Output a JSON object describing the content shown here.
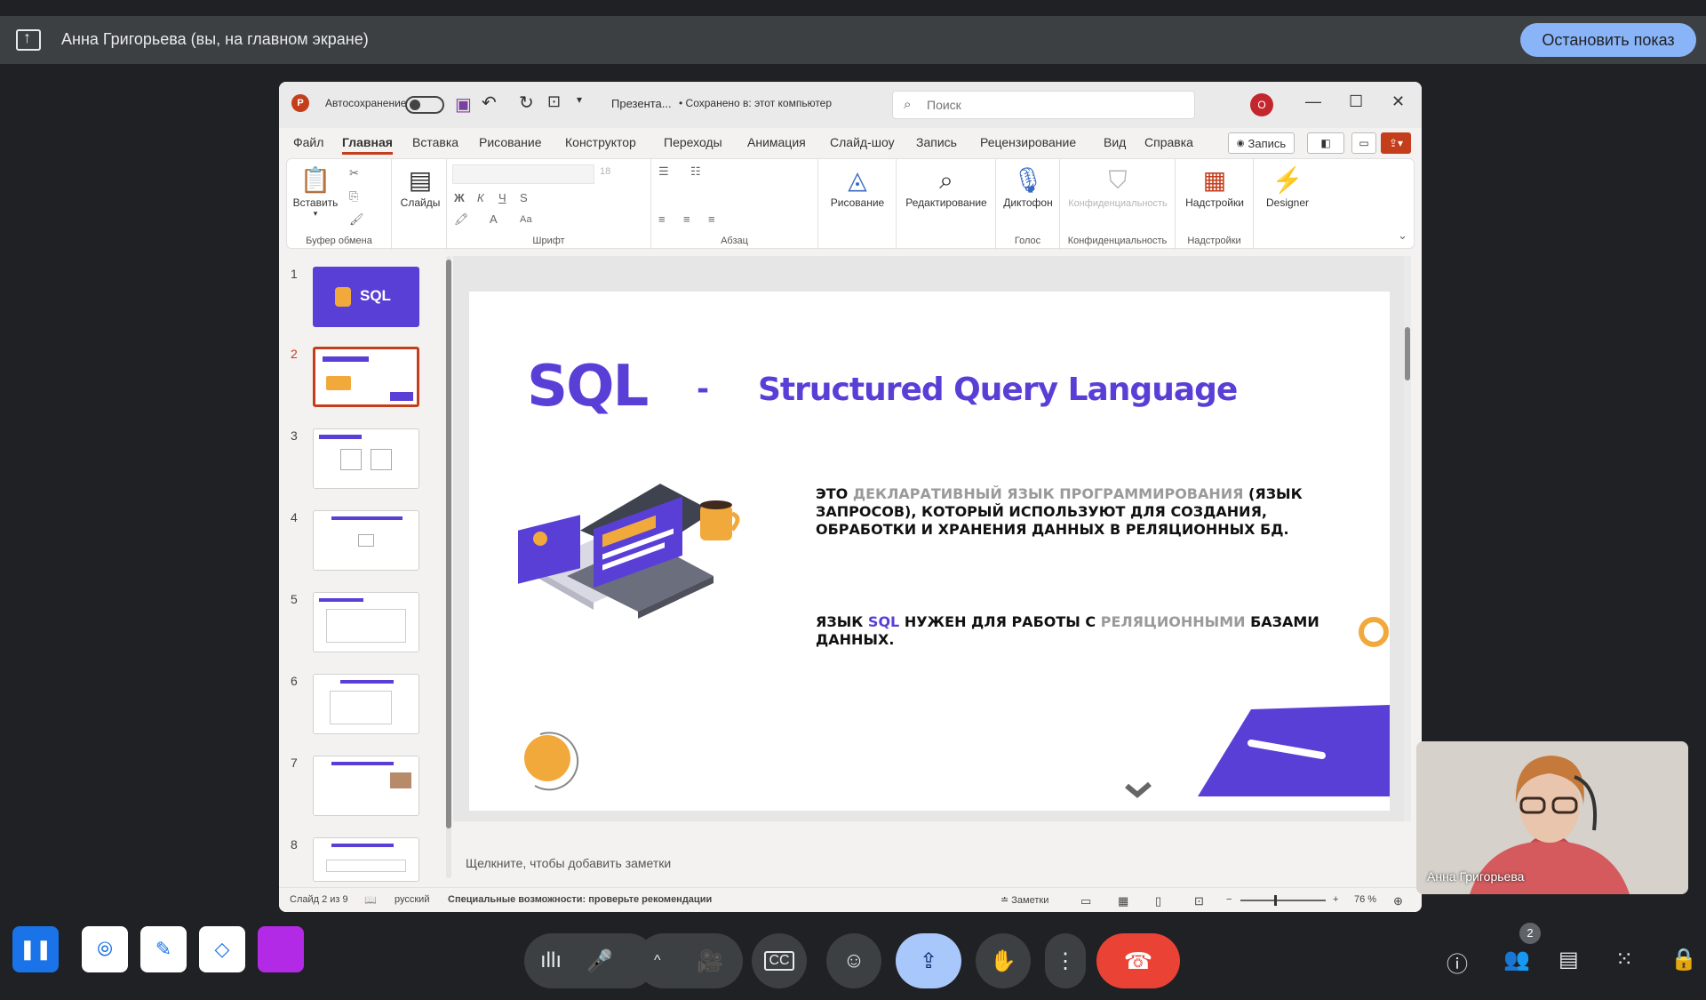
{
  "banner": {
    "text": "Анна Григорьева (вы, на главном экране)",
    "stop_label": "Остановить показ"
  },
  "ppt": {
    "autosave_label": "Автосохранение",
    "doc_title": "Презента...",
    "save_status": "• Сохранено в: этот компьютер",
    "search_placeholder": "Поиск",
    "user_initial": "О",
    "menu_tabs": [
      "Файл",
      "Главная",
      "Вставка",
      "Рисование",
      "Конструктор",
      "Переходы",
      "Анимация",
      "Слайд-шоу",
      "Запись",
      "Рецензирование",
      "Вид",
      "Справка"
    ],
    "record_label": "Запись",
    "ribbon": {
      "paste": "Вставить",
      "clipboard_group": "Буфер обмена",
      "slides": "Слайды",
      "font_size": "18",
      "font_group": "Шрифт",
      "paragraph_group": "Абзац",
      "drawing": "Рисование",
      "editing": "Редактирование",
      "dictation": "Диктофон",
      "voice_group": "Голос",
      "privacy": "Конфиденциальность",
      "privacy_group": "Конфиденциальность",
      "addins": "Надстройки",
      "addins_group": "Надстройки",
      "designer": "Designer",
      "font_bold": "Ж",
      "font_italic": "К",
      "font_underline": "Ч",
      "font_strike": "S",
      "font_case": "Аа"
    },
    "thumbnails": [
      {
        "num": "1",
        "label": "SQL"
      },
      {
        "num": "2"
      },
      {
        "num": "3"
      },
      {
        "num": "4"
      },
      {
        "num": "5"
      },
      {
        "num": "6"
      },
      {
        "num": "7"
      },
      {
        "num": "8"
      }
    ],
    "slide": {
      "title_sql": "SQL",
      "title_dash": "-",
      "title_rest": "Structured Query Language",
      "para1_a": "Это ",
      "para1_b": "декларативный язык программирования",
      "para1_c": " (язык запросов), который используют для создания, обработки и хранения данных в реляционных БД.",
      "para2_a": "Язык ",
      "para2_b": "SQL",
      "para2_c": " нужен для работы с ",
      "para2_d": "реляционными",
      "para2_e": " базами данных."
    },
    "notes_placeholder": "Щелкните, чтобы добавить заметки",
    "status": {
      "slide_info": "Слайд 2 из 9",
      "language": "русский",
      "accessibility": "Специальные возможности: проверьте рекомендации",
      "notes": "Заметки",
      "zoom": "76 %"
    }
  },
  "video": {
    "name": "Анна Григорьева"
  },
  "toolbar": {
    "participants_count": "2"
  },
  "colors": {
    "accent": "#5a3fd6",
    "meet_blue": "#8ab4f8",
    "end_call": "#ea4335",
    "ppt_red": "#c43e1c"
  }
}
